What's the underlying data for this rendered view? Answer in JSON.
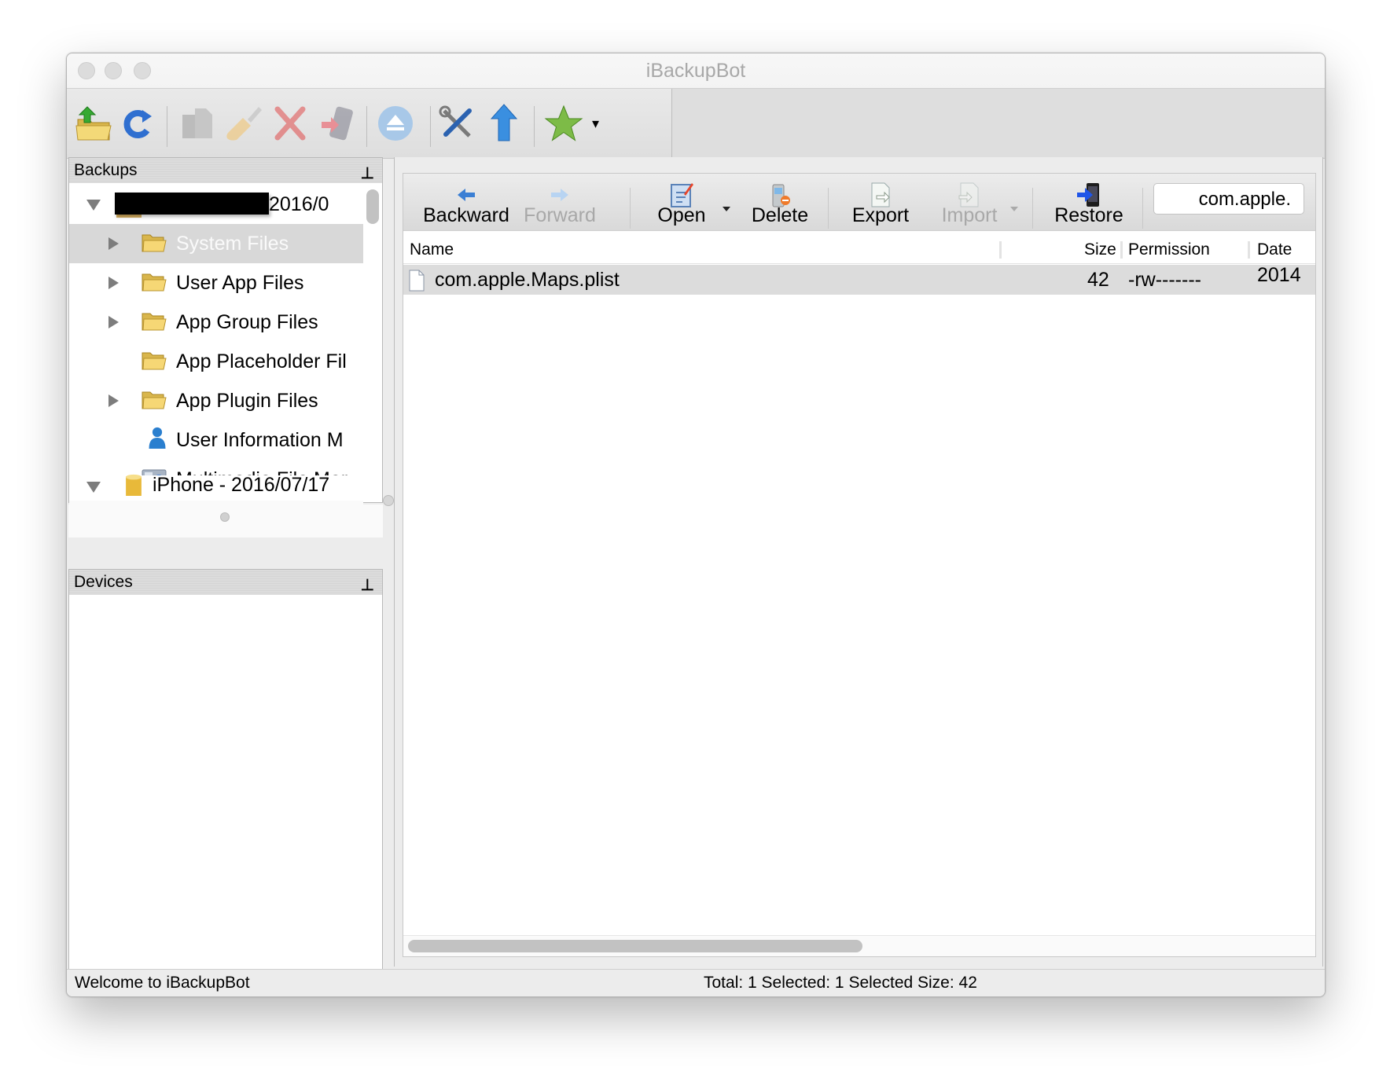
{
  "window": {
    "title": "iBackupBot"
  },
  "main_toolbar": {
    "buttons": [
      {
        "name": "open-backup-folder",
        "enabled": true
      },
      {
        "name": "refresh",
        "enabled": true
      },
      {
        "name": "duplicate",
        "enabled": false
      },
      {
        "name": "clean",
        "enabled": false
      },
      {
        "name": "delete-backup",
        "enabled": false
      },
      {
        "name": "restore-to-device",
        "enabled": false
      },
      {
        "name": "eject",
        "enabled": false
      },
      {
        "name": "tools",
        "enabled": true
      },
      {
        "name": "upload",
        "enabled": true
      },
      {
        "name": "favorites",
        "enabled": true
      }
    ],
    "overflow_icon": "▾"
  },
  "backups_panel": {
    "title": "Backups",
    "pin_icon": "📌",
    "tree": [
      {
        "label": "2016/0",
        "expanded": true,
        "redacted": true,
        "level": 0
      },
      {
        "label": "System Files",
        "expandable": true,
        "selected": true,
        "icon": "folder",
        "level": 1
      },
      {
        "label": "User App Files",
        "expandable": true,
        "icon": "folder",
        "level": 1
      },
      {
        "label": "App Group Files",
        "expandable": true,
        "icon": "folder",
        "level": 1
      },
      {
        "label": "App Placeholder Fil",
        "expandable": false,
        "icon": "folder",
        "level": 1
      },
      {
        "label": "App Plugin Files",
        "expandable": true,
        "icon": "folder",
        "level": 1
      },
      {
        "label": "User Information M",
        "expandable": false,
        "icon": "user",
        "level": 1
      },
      {
        "label": "Multimedia File Mar",
        "expandable": false,
        "icon": "multimedia",
        "level": 1
      },
      {
        "label": "iPhone - 2016/07/17",
        "expanded": true,
        "icon": "database",
        "level": 0
      }
    ]
  },
  "devices_panel": {
    "title": "Devices"
  },
  "file_toolbar": {
    "backward": "Backward",
    "forward": "Forward",
    "open": "Open",
    "delete": "Delete",
    "export": "Export",
    "import": "Import",
    "restore": "Restore",
    "search_value": "com.apple."
  },
  "file_table": {
    "columns": [
      "Name",
      "Size",
      "Permission",
      "Date"
    ],
    "rows": [
      {
        "name": "com.apple.Maps.plist",
        "size": "42",
        "permission": "-rw-------",
        "date": "2014"
      }
    ]
  },
  "status_bar": {
    "left": "Welcome to iBackupBot",
    "right": "Total: 1 Selected: 1 Selected Size: 42"
  },
  "colors": {
    "selection_row": "#dcdcdc",
    "disabled_text": "#a8a8a8",
    "accent_blue": "#3b7fd4"
  }
}
